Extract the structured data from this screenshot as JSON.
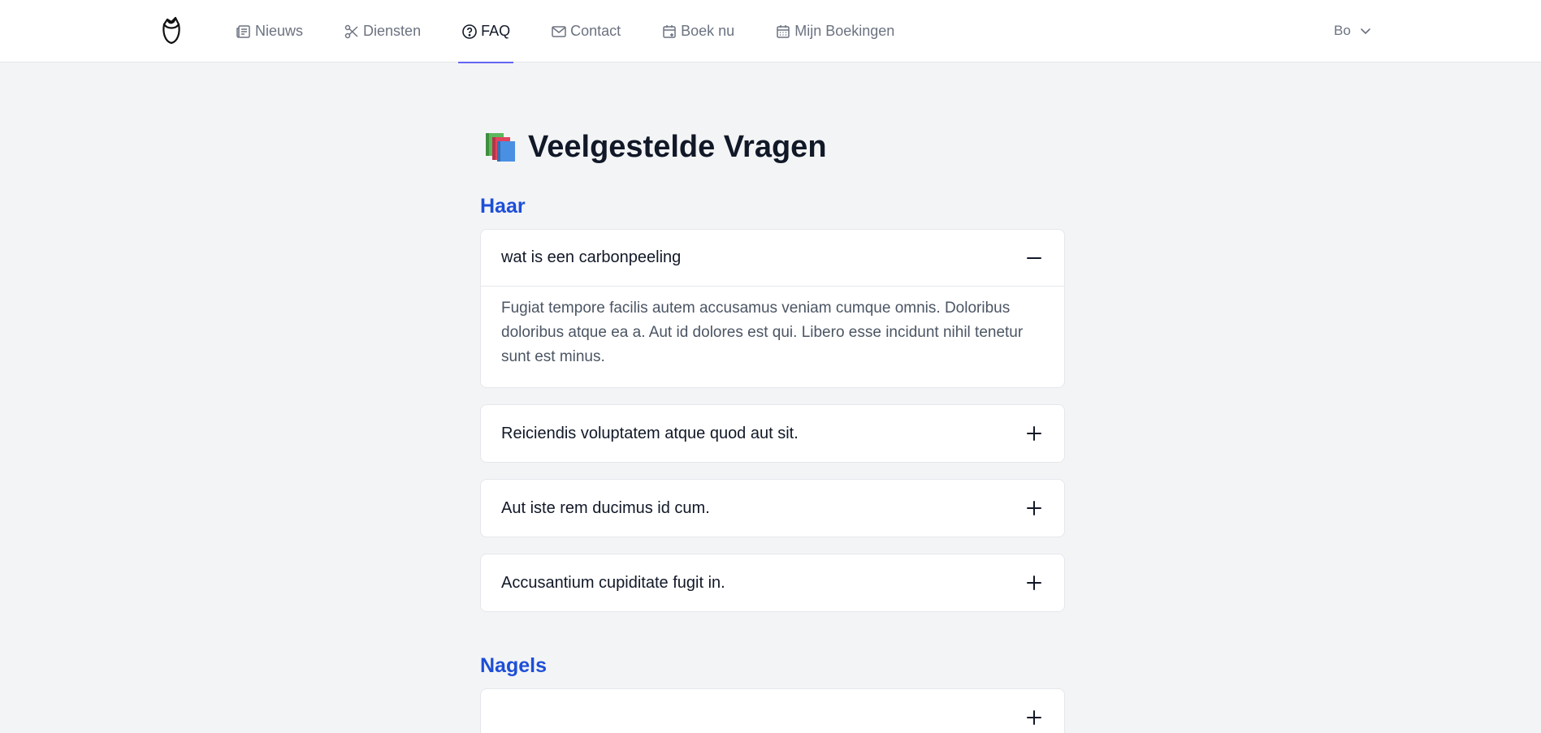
{
  "nav": {
    "items": [
      {
        "label": "Nieuws",
        "icon": "newspaper-icon"
      },
      {
        "label": "Diensten",
        "icon": "scissors-icon"
      },
      {
        "label": "FAQ",
        "icon": "question-circle-icon"
      },
      {
        "label": "Contact",
        "icon": "envelope-icon"
      },
      {
        "label": "Boek nu",
        "icon": "calendar-plus-icon"
      },
      {
        "label": "Mijn Boekingen",
        "icon": "calendar-icon"
      }
    ],
    "active": "FAQ",
    "user": "Bo"
  },
  "page": {
    "title": "Veelgestelde Vragen",
    "title_icon": "books-icon"
  },
  "sections": [
    {
      "title": "Haar",
      "faqs": [
        {
          "question": "wat is een carbonpeeling",
          "answer": "Fugiat tempore facilis autem accusamus veniam cumque omnis. Doloribus doloribus atque ea a. Aut id dolores est qui. Libero esse incidunt nihil tenetur sunt est minus.",
          "open": true
        },
        {
          "question": "Reiciendis voluptatem atque quod aut sit.",
          "open": false
        },
        {
          "question": "Aut iste rem ducimus id cum.",
          "open": false
        },
        {
          "question": "Accusantium cupiditate fugit in.",
          "open": false
        }
      ]
    },
    {
      "title": "Nagels",
      "faqs": []
    }
  ],
  "colors": {
    "accent": "#6366f1",
    "section_title": "#1d4ed8",
    "background": "#f3f4f6"
  }
}
